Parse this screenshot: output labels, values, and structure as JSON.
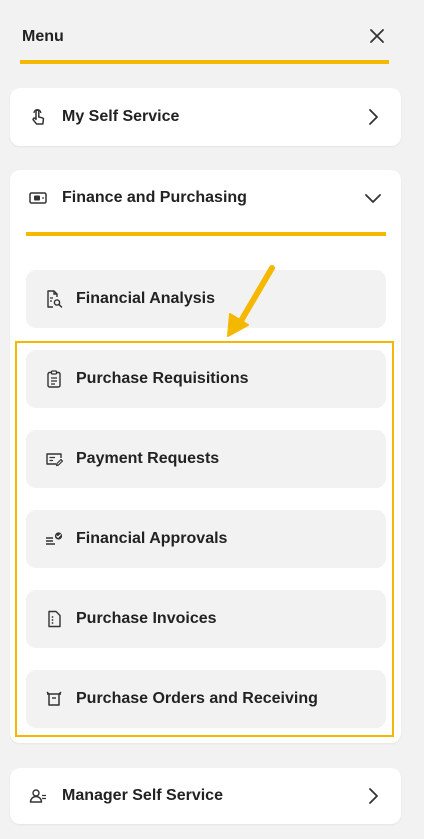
{
  "header": {
    "title": "Menu",
    "close_icon": "close-icon"
  },
  "accent_color": "#f5b800",
  "my_self_service": {
    "label": "My Self Service",
    "icon": "touch-hand-icon"
  },
  "finance": {
    "label": "Finance and Purchasing",
    "icon": "cash-icon",
    "expanded": true,
    "items": [
      {
        "label": "Financial Analysis",
        "icon": "document-search-icon"
      },
      {
        "label": "Purchase Requisitions",
        "icon": "clipboard-icon"
      },
      {
        "label": "Payment Requests",
        "icon": "edit-card-icon"
      },
      {
        "label": "Financial Approvals",
        "icon": "approval-list-icon"
      },
      {
        "label": "Purchase Invoices",
        "icon": "invoice-icon"
      },
      {
        "label": "Purchase Orders and Receiving",
        "icon": "basket-icon"
      }
    ]
  },
  "manager_self_service": {
    "label": "Manager Self Service",
    "icon": "people-icon"
  }
}
